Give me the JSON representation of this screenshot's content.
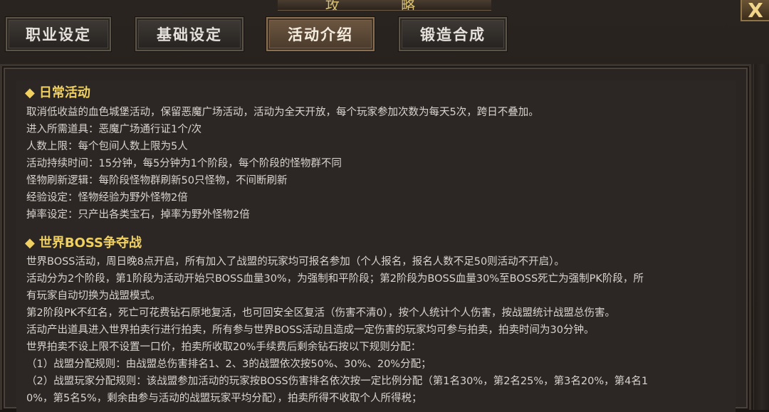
{
  "window": {
    "title": "攻 略",
    "close_label": "X"
  },
  "tabs": [
    {
      "label": "职业设定",
      "active": false
    },
    {
      "label": "基础设定",
      "active": false
    },
    {
      "label": "活动介绍",
      "active": true
    },
    {
      "label": "锻造合成",
      "active": false
    }
  ],
  "content": {
    "daily": {
      "marker": "◆",
      "title": "日常活动",
      "lines": [
        "取消低收益的血色城堡活动，保留恶魔广场活动，活动为全天开放，每个玩家参加次数为每天5次，跨日不叠加。",
        "进入所需道具：恶魔广场通行证1个/次",
        "人数上限：每个包间人数上限为5人",
        "活动持续时间：15分钟，每5分钟为1个阶段，每个阶段的怪物群不同",
        "怪物刷新逻辑：每阶段怪物群刷新50只怪物，不间断刷新",
        "经验设定：怪物经验为野外怪物2倍",
        "掉率设定：只产出各类宝石，掉率为野外怪物2倍"
      ]
    },
    "boss": {
      "marker": "◆",
      "title": "世界BOSS争夺战",
      "lines": [
        "世界BOSS活动，周日晚8点开启，所有加入了战盟的玩家均可报名参加（个人报名，报名人数不足50则活动不开启）。",
        "活动分为2个阶段，第1阶段为活动开始只BOSS血量30%，为强制和平阶段；第2阶段为BOSS血量30%至BOSS死亡为强制PK阶段，所",
        "有玩家自动切换为战盟模式。",
        "第2阶段PK不红名，死亡可花费钻石原地复活，也可回安全区复活（伤害不清0），按个人统计个人伤害，按战盟统计战盟总伤害。",
        "活动产出道具进入世界拍卖行进行拍卖，所有参与世界BOSS活动且造成一定伤害的玩家均可参与拍卖，拍卖时间为30分钟。",
        "世界拍卖不设上限不设置一口价，拍卖所收取20%手续费后剩余钻石按以下规则分配：",
        "（1）战盟分配规则：由战盟总伤害排名1、2、3的战盟依次按50%、30%、20%分配；",
        "（2）战盟玩家分配规则：该战盟参加活动的玩家按BOSS伤害排名依次按一定比例分配（第1名30%，第2名25%，第3名20%，第4名1",
        "0%，第5名5%，剩余由参与活动的战盟玩家平均分配），拍卖所得不收取个人所得税；"
      ]
    }
  }
}
